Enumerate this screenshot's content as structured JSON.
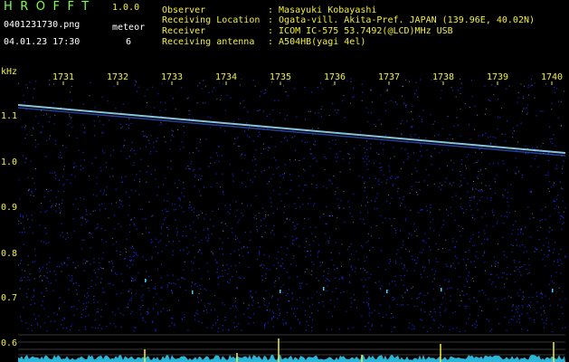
{
  "app": {
    "title": "HROFFT",
    "version": "1.0.0"
  },
  "file": {
    "name": "0401231730.png",
    "datetime": "04.01.23 17:30"
  },
  "meteor": {
    "label": "meteor",
    "count": "6"
  },
  "info": [
    {
      "key": "Observer",
      "value": ": Masayuki Kobayashi"
    },
    {
      "key": "Receiving Location",
      "value": ": Ogata-vill. Akita-Pref. JAPAN (139.96E, 40.02N)"
    },
    {
      "key": "Receiver",
      "value": ": ICOM IC-575 53.7492(@LCD)MHz USB"
    },
    {
      "key": "Receiving antenna",
      "value": ": A504HB(yagi 4el)"
    }
  ],
  "axis": {
    "unit": "kHz",
    "y_ticks": [
      "1.1",
      "1.0",
      "0.9",
      "0.8",
      "0.7",
      "0.6"
    ],
    "x_ticks": [
      "1731",
      "1732",
      "1733",
      "1734",
      "1735",
      "1736",
      "1737",
      "1738",
      "1739",
      "1740"
    ]
  },
  "colors": {
    "label": "#f2ee3a",
    "title": "#7dff4a",
    "noise": "#1a2cff",
    "trace": "#9fe6ff",
    "spectrum": "#33d6ff",
    "grid": "#c8c8c8"
  }
}
